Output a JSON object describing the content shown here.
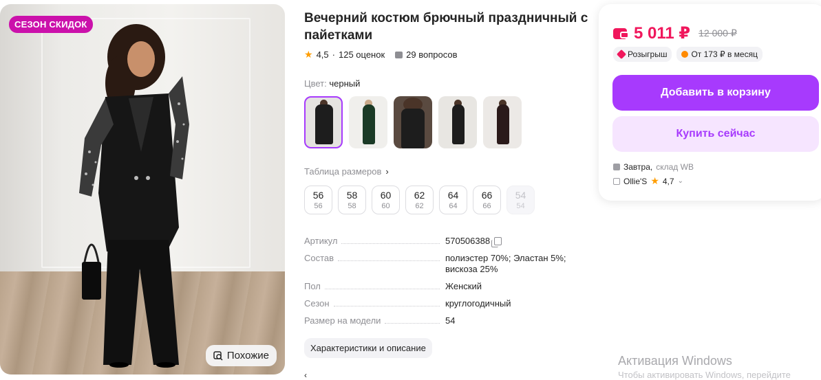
{
  "product_image": {
    "badge": "СЕЗОН СКИДОК",
    "similar_label": "Похожие"
  },
  "product": {
    "title": "Вечерний костюм брючный праздничный с пайетками",
    "rating": "4,5",
    "separator": "·",
    "reviews": "125 оценок",
    "questions": "29 вопросов"
  },
  "color": {
    "label": "Цвет:",
    "value": "черный"
  },
  "size_table_link": "Таблица размеров",
  "sizes": [
    {
      "main": "56",
      "sub": "56"
    },
    {
      "main": "58",
      "sub": "58"
    },
    {
      "main": "60",
      "sub": "60"
    },
    {
      "main": "62",
      "sub": "62"
    },
    {
      "main": "64",
      "sub": "64"
    },
    {
      "main": "66",
      "sub": "66"
    },
    {
      "main": "54",
      "sub": "54"
    }
  ],
  "params": [
    {
      "name": "Артикул",
      "value": "570506388"
    },
    {
      "name": "Состав",
      "value": "полиэстер 70%; Эластан 5%; вискоза 25%"
    },
    {
      "name": "Пол",
      "value": "Женский"
    },
    {
      "name": "Сезон",
      "value": "круглогодичный"
    },
    {
      "name": "Размер на модели",
      "value": "54"
    }
  ],
  "description_button": "Характеристики и описание",
  "price": {
    "current": "5 011 ₽",
    "old": "12 000 ₽",
    "chip_raffle": "Розыгрыш",
    "chip_installment": "От 173 ₽ в месяц"
  },
  "actions": {
    "add_to_cart": "Добавить в корзину",
    "buy_now": "Купить сейчас"
  },
  "delivery": {
    "day": "Завтра,",
    "warehouse": "склад WB"
  },
  "seller": {
    "name": "Ollie'S",
    "rating": "4,7"
  },
  "watermark": {
    "line1": "Активация Windows",
    "line2": "Чтобы активировать Windows, перейдите"
  },
  "colors": {
    "accent": "#a73afd",
    "price": "#f0175c",
    "badge": "#cb11ab"
  }
}
